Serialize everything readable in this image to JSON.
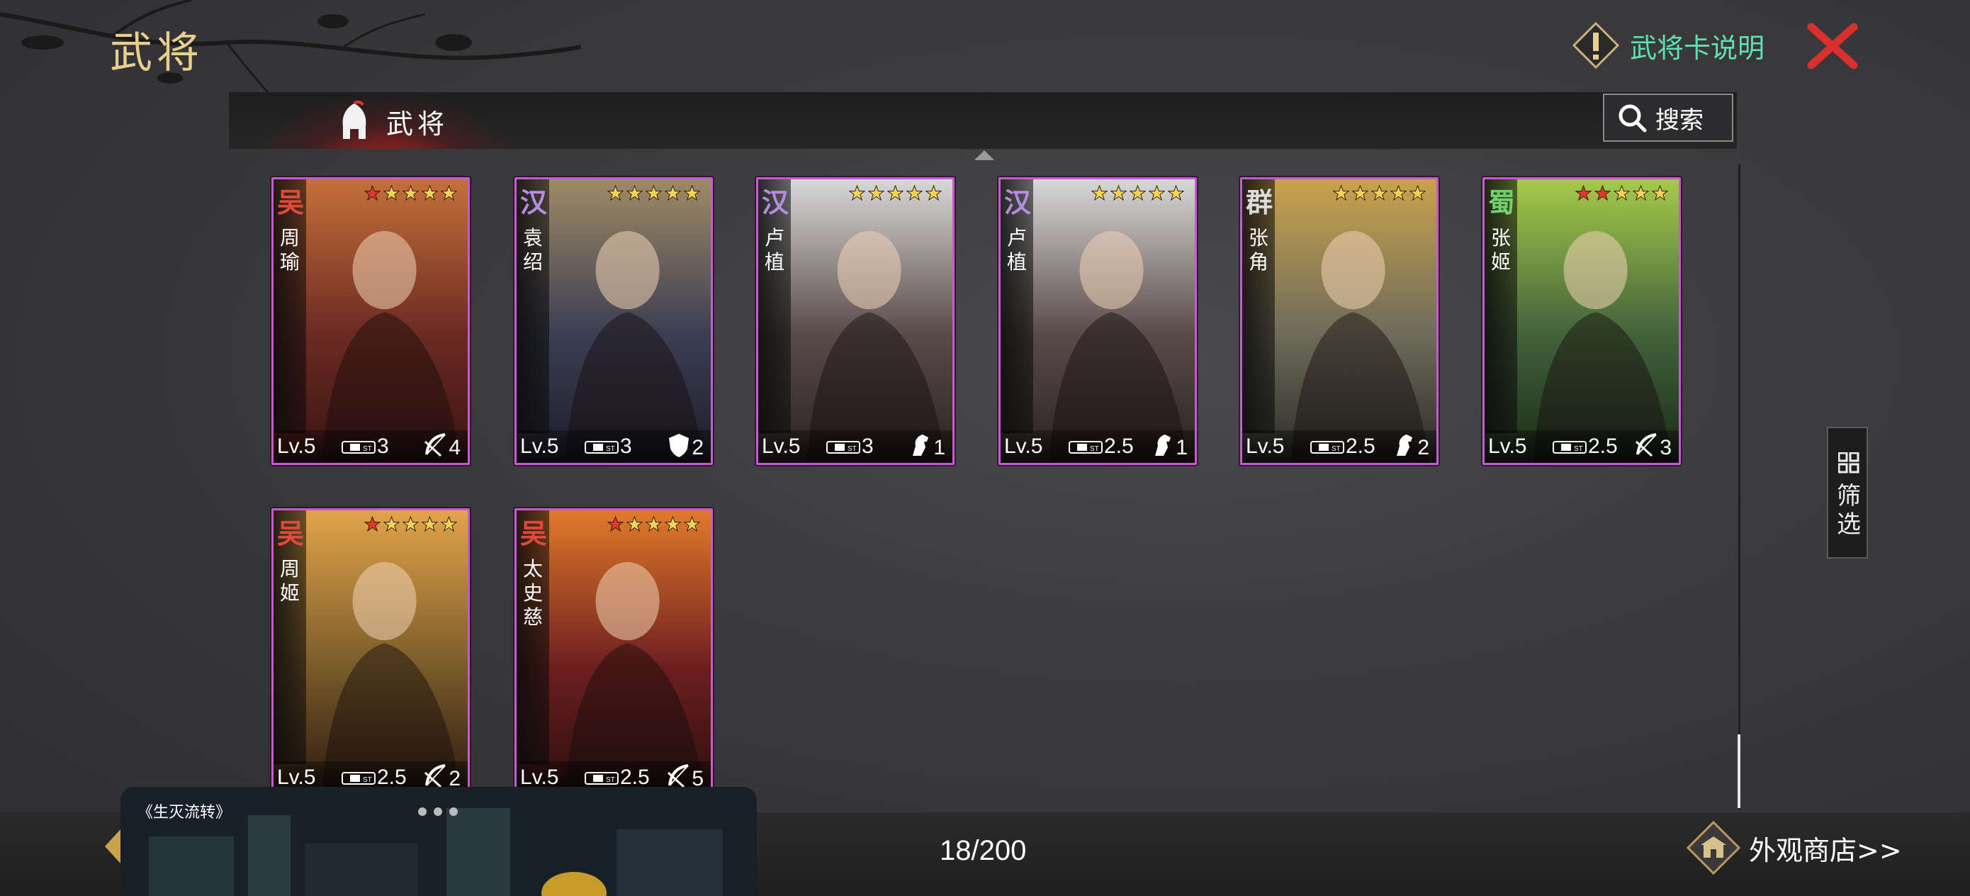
{
  "header": {
    "title": "武将",
    "help_label": "武将卡说明"
  },
  "tabs": [
    {
      "label": "武将",
      "active": true
    }
  ],
  "search": {
    "label": "搜索"
  },
  "filter": {
    "label": "筛选"
  },
  "cards": [
    {
      "faction": "吴",
      "faction_color": "#e04a3c",
      "name": "周瑜",
      "rarity_red": 1,
      "stars": 5,
      "level": "Lv.5",
      "cost": "3",
      "type_icon": "bow-icon",
      "count": "4",
      "palette": [
        "#6b2a22",
        "#c4703a",
        "#3a1412"
      ]
    },
    {
      "faction": "汉",
      "faction_color": "#b48ce0",
      "name": "袁绍",
      "rarity_red": 0,
      "stars": 5,
      "level": "Lv.5",
      "cost": "3",
      "type_icon": "shield-icon",
      "count": "2",
      "palette": [
        "#3b3d52",
        "#9e8a66",
        "#1d1e2a"
      ]
    },
    {
      "faction": "汉",
      "faction_color": "#b48ce0",
      "name": "卢植",
      "rarity_red": 0,
      "stars": 5,
      "level": "Lv.5",
      "cost": "3",
      "type_icon": "horse-icon",
      "count": "1",
      "palette": [
        "#5a4a4a",
        "#d8d8d8",
        "#2a2222"
      ]
    },
    {
      "faction": "汉",
      "faction_color": "#b48ce0",
      "name": "卢植",
      "rarity_red": 0,
      "stars": 5,
      "level": "Lv.5",
      "cost": "2.5",
      "type_icon": "horse-icon",
      "count": "1",
      "palette": [
        "#5a4a4a",
        "#d8d8d8",
        "#2a2222"
      ]
    },
    {
      "faction": "群",
      "faction_color": "#dcdcdc",
      "name": "张角",
      "rarity_red": 0,
      "stars": 5,
      "level": "Lv.5",
      "cost": "2.5",
      "type_icon": "horse-icon",
      "count": "2",
      "palette": [
        "#6d6b5a",
        "#c9a24c",
        "#2a2a26"
      ]
    },
    {
      "faction": "蜀",
      "faction_color": "#6fd06f",
      "name": "张姬",
      "rarity_red": 2,
      "stars": 5,
      "level": "Lv.5",
      "cost": "2.5",
      "type_icon": "bow-icon",
      "count": "3",
      "palette": [
        "#41623a",
        "#a6c94a",
        "#1b2a18"
      ]
    },
    {
      "faction": "吴",
      "faction_color": "#e04a3c",
      "name": "周姬",
      "rarity_red": 1,
      "stars": 5,
      "level": "Lv.5",
      "cost": "2.5",
      "type_icon": "bow-icon",
      "count": "2",
      "palette": [
        "#7a5b2a",
        "#e2a44a",
        "#2c1a10"
      ]
    },
    {
      "faction": "吴",
      "faction_color": "#e04a3c",
      "name": "太史慈",
      "rarity_red": 1,
      "stars": 5,
      "level": "Lv.5",
      "cost": "2.5",
      "type_icon": "bow-icon",
      "count": "5",
      "palette": [
        "#6e1f1f",
        "#e07a2a",
        "#2a0f0f"
      ]
    }
  ],
  "footer": {
    "page_count": "18/200",
    "shop_label": "外观商店>>"
  },
  "overlay": {
    "title": "《生灭流转》"
  },
  "colors": {
    "accent_gold": "#e8cf8e",
    "accent_green": "#5fe0b0",
    "card_border": "#c55bd0",
    "close_red": "#d9302e"
  }
}
